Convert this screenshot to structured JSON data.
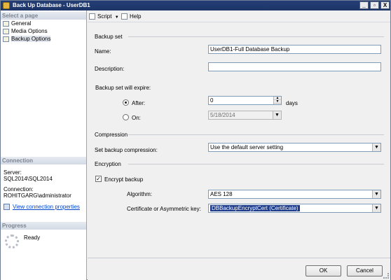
{
  "window": {
    "title": "Back Up Database - UserDB1",
    "controls": [
      "_",
      "▫",
      "X"
    ]
  },
  "sidebar": {
    "select_page_header": "Select a page",
    "items": [
      {
        "label": "General"
      },
      {
        "label": "Media Options"
      },
      {
        "label": "Backup Options"
      }
    ],
    "connection_header": "Connection",
    "server_label": "Server:",
    "server_value": "SQL2014\\SQL2014",
    "connection_label": "Connection:",
    "connection_value": "ROHITGARG\\administrator",
    "view_connection_link": "View connection properties",
    "progress_header": "Progress",
    "progress_status": "Ready"
  },
  "toolbar": {
    "script_label": "Script",
    "help_label": "Help"
  },
  "form": {
    "backup_set_group": "Backup set",
    "name_label": "Name:",
    "name_value": "UserDB1-Full Database Backup",
    "description_label": "Description:",
    "description_value": "",
    "expire_label": "Backup set will expire:",
    "after_label": "After:",
    "after_value": "0",
    "days_label": "days",
    "on_label": "On:",
    "on_value": "5/18/2014",
    "compression_group": "Compression",
    "compression_label": "Set backup compression:",
    "compression_value": "Use the default server setting",
    "encryption_group": "Encryption",
    "encrypt_label": "Encrypt backup",
    "encrypt_checked": true,
    "algorithm_label": "Algorithm:",
    "algorithm_value": "AES 128",
    "certificate_label": "Certificate or Asymmetric key:",
    "certificate_value": "DBBackupEncryptCert (Certificate)"
  },
  "footer": {
    "ok_label": "OK",
    "cancel_label": "Cancel"
  }
}
